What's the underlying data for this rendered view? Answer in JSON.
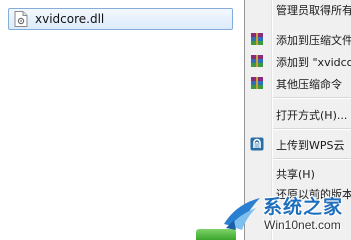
{
  "explorer": {
    "file": {
      "name": "xvidcore.dll",
      "icon": "dll-file-icon"
    }
  },
  "context_menu": {
    "items": [
      {
        "label": "管理员取得所有",
        "icon": ""
      },
      {
        "label": "添加到压缩文件",
        "icon": "winrar-archive-icon"
      },
      {
        "label": "添加到 \"xvidco",
        "icon": "winrar-archive-icon"
      },
      {
        "label": "其他压缩命令",
        "icon": "winrar-archive-icon"
      },
      {
        "label": "打开方式(H)...",
        "icon": ""
      },
      {
        "label": "上传到WPS云",
        "icon": "wps-cloud-icon"
      },
      {
        "label": "共享(H)",
        "icon": ""
      },
      {
        "label": "还原以前的版本",
        "icon": ""
      }
    ]
  },
  "watermark": {
    "title": "系统之家",
    "url": "Win10net.com"
  },
  "colors": {
    "selection_bg": "#dcebfc",
    "selection_border": "#84acdd",
    "menu_bg": "#f0f0f0",
    "watermark_blue": "#1f6fbd"
  }
}
